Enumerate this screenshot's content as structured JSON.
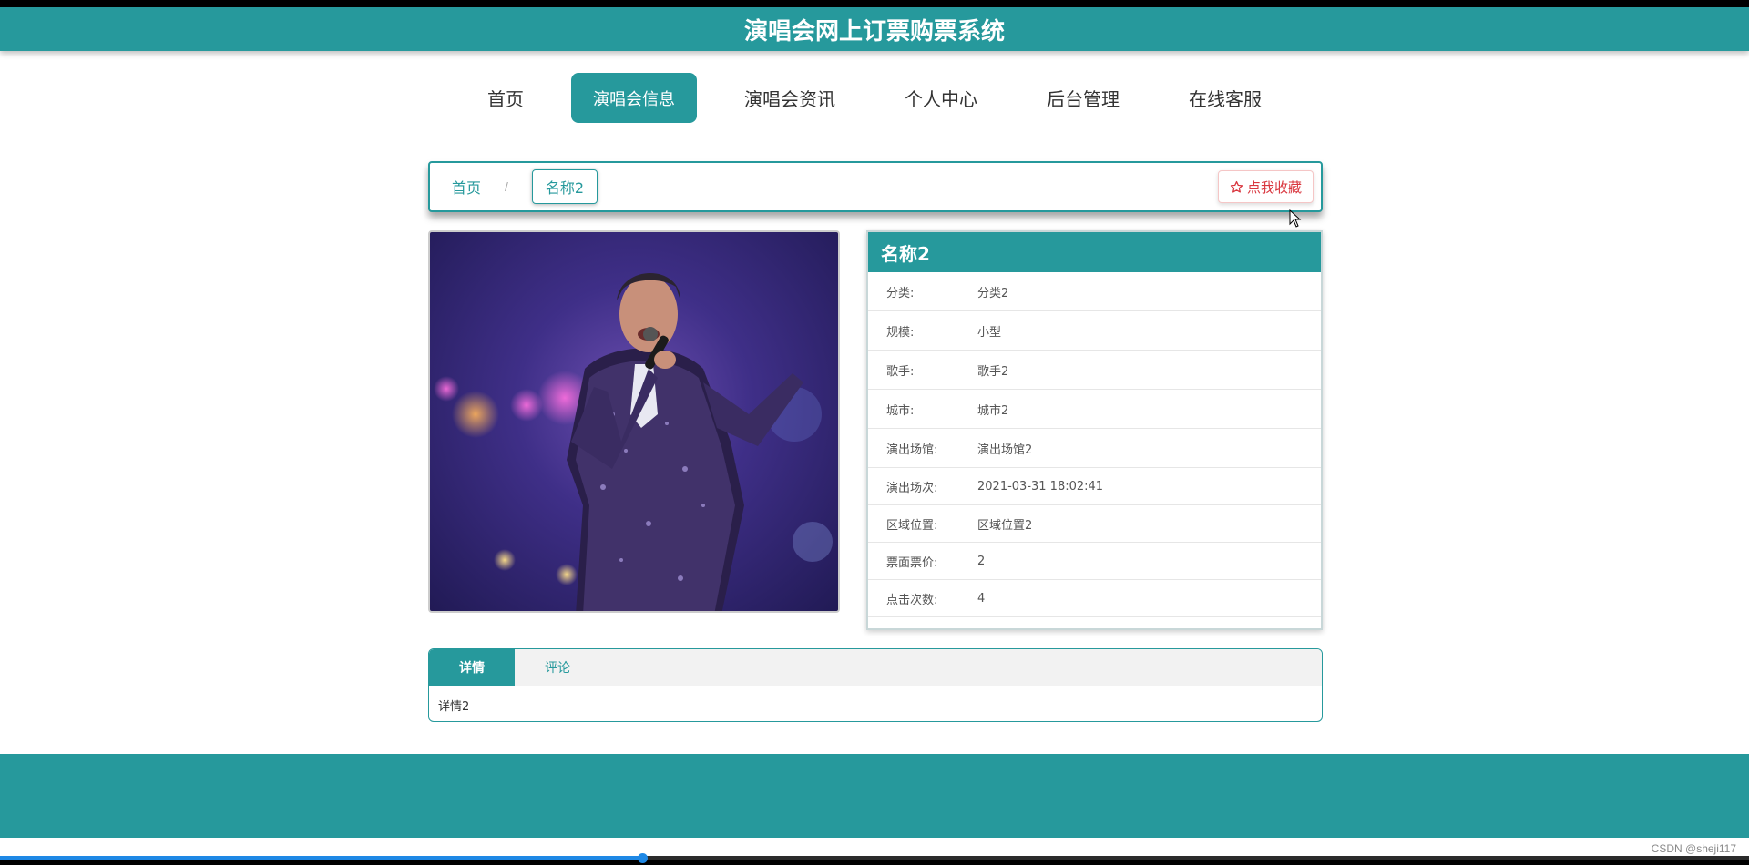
{
  "header": {
    "title": "演唱会网上订票购票系统"
  },
  "nav": {
    "items": [
      {
        "label": "首页",
        "active": false
      },
      {
        "label": "演唱会信息",
        "active": true
      },
      {
        "label": "演唱会资讯",
        "active": false
      },
      {
        "label": "个人中心",
        "active": false
      },
      {
        "label": "后台管理",
        "active": false
      },
      {
        "label": "在线客服",
        "active": false
      }
    ]
  },
  "breadcrumb": {
    "home": "首页",
    "separator": "/",
    "current": "名称2"
  },
  "favorite": {
    "icon": "star-outline-icon",
    "label": "点我收藏"
  },
  "info": {
    "title": "名称2",
    "rows": [
      {
        "key": "分类:",
        "value": "分类2"
      },
      {
        "key": "规模:",
        "value": "小型"
      },
      {
        "key": "歌手:",
        "value": "歌手2"
      },
      {
        "key": "城市:",
        "value": "城市2"
      },
      {
        "key": "演出场馆:",
        "value": "演出场馆2"
      },
      {
        "key": "演出场次:",
        "value": "2021-03-31 18:02:41"
      },
      {
        "key": "区域位置:",
        "value": "区域位置2"
      },
      {
        "key": "票面票价:",
        "value": "2"
      },
      {
        "key": "点击次数:",
        "value": "4"
      }
    ]
  },
  "tabs": {
    "items": [
      {
        "label": "详情",
        "active": true
      },
      {
        "label": "评论",
        "active": false
      }
    ],
    "content": "详情2"
  },
  "watermark": "CSDN @sheji117",
  "video_progress": 0.367,
  "colors": {
    "primary": "#26999c",
    "favorite": "#d9363e",
    "progress": "#1e88e5"
  }
}
